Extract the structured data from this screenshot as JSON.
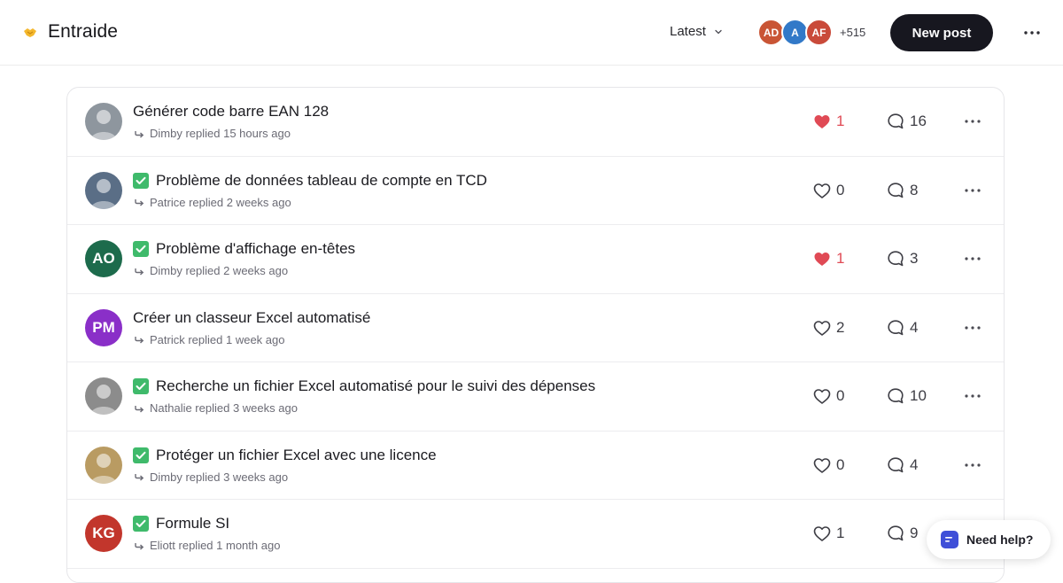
{
  "header": {
    "title": "Entraide",
    "sort_label": "Latest",
    "members": [
      {
        "initials": "AD",
        "color": "#c95535"
      },
      {
        "initials": "A",
        "color": "#3279c8"
      },
      {
        "initials": "AF",
        "color": "#c94a3a"
      }
    ],
    "member_count": "+515",
    "new_post_label": "New post"
  },
  "posts": [
    {
      "title": "Générer code barre EAN 128",
      "solved": false,
      "meta": "Dimby replied 15 hours ago",
      "likes": "1",
      "liked": true,
      "comments": "16",
      "avatar": {
        "type": "photo",
        "color": "#8e969e",
        "initials": ""
      }
    },
    {
      "title": "Problème de données tableau de compte en TCD",
      "solved": true,
      "meta": "Patrice replied 2 weeks ago",
      "likes": "0",
      "liked": false,
      "comments": "8",
      "avatar": {
        "type": "photo",
        "color": "#5a6e86",
        "initials": ""
      }
    },
    {
      "title": "Problème d'affichage en-têtes",
      "solved": true,
      "meta": "Dimby replied 2 weeks ago",
      "likes": "1",
      "liked": true,
      "comments": "3",
      "avatar": {
        "type": "initials",
        "color": "#1d6b4c",
        "initials": "AO"
      }
    },
    {
      "title": "Créer un classeur Excel automatisé",
      "solved": false,
      "meta": "Patrick replied 1 week ago",
      "likes": "2",
      "liked": false,
      "comments": "4",
      "avatar": {
        "type": "initials",
        "color": "#8a2fc8",
        "initials": "PM"
      }
    },
    {
      "title": "Recherche un fichier Excel automatisé pour le suivi des dépenses",
      "solved": true,
      "meta": "Nathalie replied 3 weeks ago",
      "likes": "0",
      "liked": false,
      "comments": "10",
      "avatar": {
        "type": "photo",
        "color": "#8c8c8c",
        "initials": ""
      }
    },
    {
      "title": "Protéger un fichier Excel avec une licence",
      "solved": true,
      "meta": "Dimby replied 3 weeks ago",
      "likes": "0",
      "liked": false,
      "comments": "4",
      "avatar": {
        "type": "photo",
        "color": "#b99b62",
        "initials": ""
      }
    },
    {
      "title": "Formule SI",
      "solved": true,
      "meta": "Eliott replied 1 month ago",
      "likes": "1",
      "liked": false,
      "comments": "9",
      "avatar": {
        "type": "initials",
        "color": "#c2362c",
        "initials": "KG"
      }
    }
  ],
  "help": {
    "label": "Need help?"
  },
  "colors": {
    "accent": "#17171f",
    "like_active": "#e04a55",
    "solved": "#3fba6b",
    "help_icon": "#3f4fd8"
  }
}
